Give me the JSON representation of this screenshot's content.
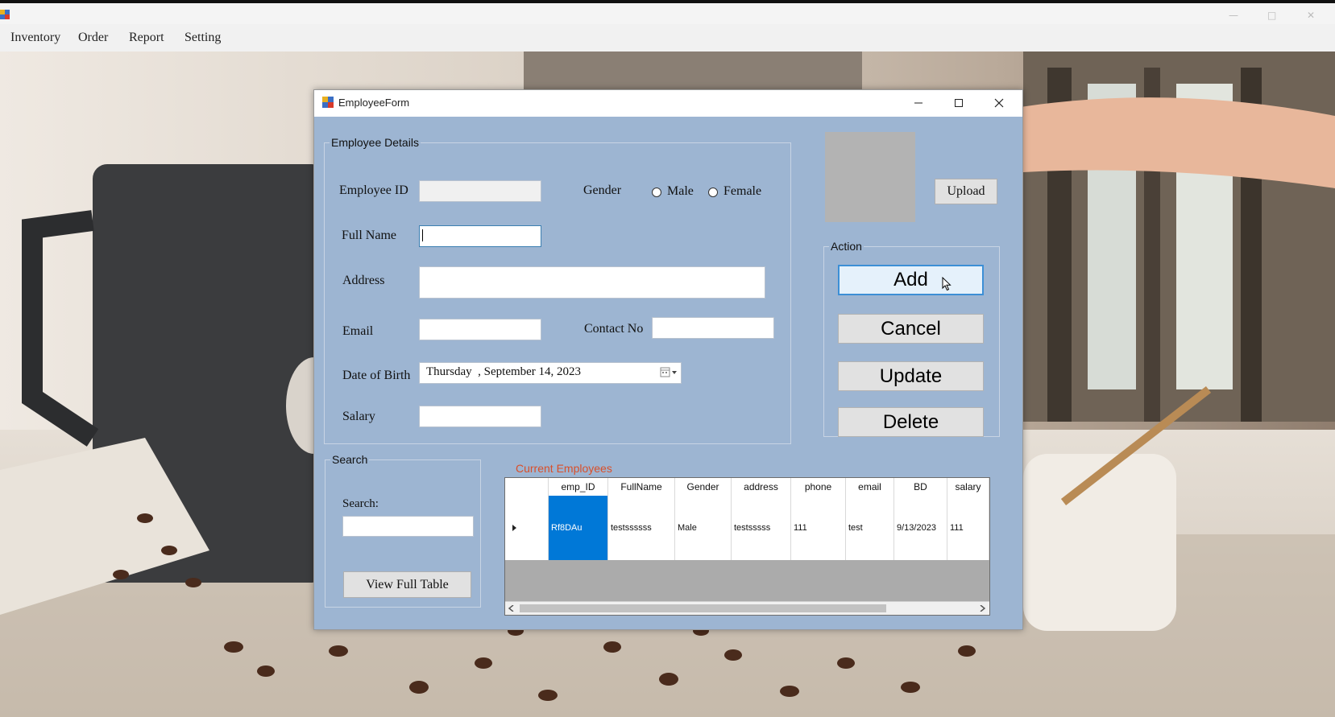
{
  "menu": [
    "Inventory",
    "Order",
    "Report",
    "Setting"
  ],
  "window": {
    "title": "EmployeeForm",
    "controls": {
      "minimize": "minimize",
      "maximize": "maximize",
      "close": "close"
    }
  },
  "details": {
    "legend": "Employee Details",
    "employee_id_label": "Employee ID",
    "employee_id_value": "",
    "gender_label": "Gender",
    "gender_male": "Male",
    "gender_female": "Female",
    "full_name_label": "Full Name",
    "full_name_value": "",
    "address_label": "Address",
    "address_value": "",
    "email_label": "Email",
    "email_value": "",
    "contact_label": "Contact No",
    "contact_value": "",
    "dob_label": "Date of Birth",
    "dob_value": "Thursday  , September 14, 2023",
    "salary_label": "Salary",
    "salary_value": ""
  },
  "photo": {
    "upload_label": "Upload"
  },
  "action": {
    "legend": "Action",
    "add": "Add",
    "cancel": "Cancel",
    "update": "Update",
    "delete": "Delete"
  },
  "search": {
    "legend": "Search",
    "label": "Search:",
    "value": "",
    "view_full_table": "View Full Table"
  },
  "grid": {
    "label": "Current Employees",
    "columns": [
      "emp_ID",
      "FullName",
      "Gender",
      "address",
      "phone",
      "email",
      "BD",
      "salary"
    ],
    "rows": [
      [
        "Rf8DAu",
        "testssssss",
        "Male",
        "testsssss",
        "111",
        "test",
        "9/13/2023",
        "111"
      ]
    ]
  },
  "colors": {
    "client_bg": "#9db5d2",
    "selection": "#0078d7",
    "grid_label": "#d94f2a",
    "button_hot_border": "#3c8fd6"
  }
}
